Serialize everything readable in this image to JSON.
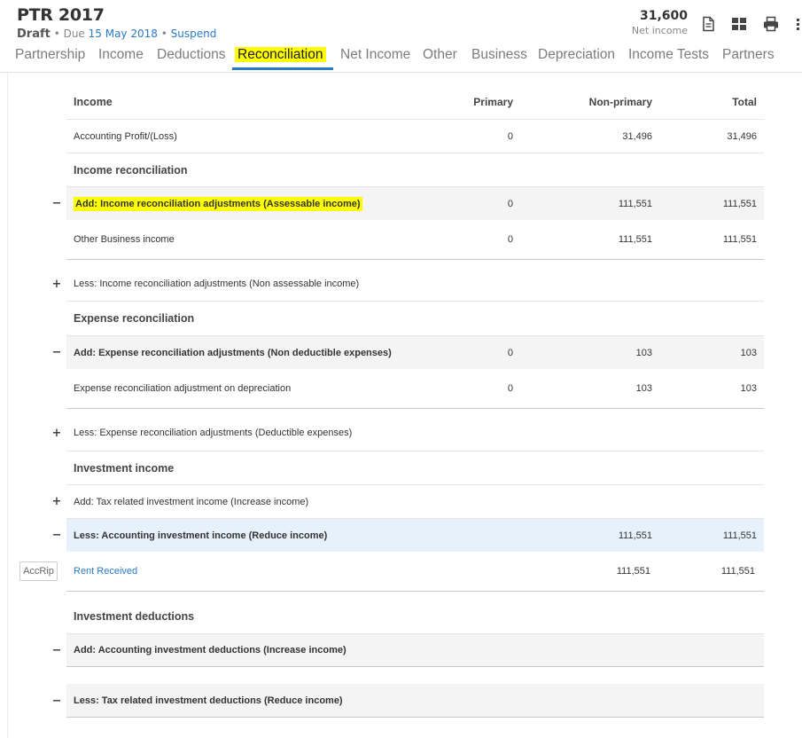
{
  "header": {
    "title": "PTR 2017",
    "status": "Draft",
    "due_prefix": "• Due",
    "due_date": "15 May 2018",
    "separator": "•",
    "suspend": "Suspend",
    "net_income_value": "31,600",
    "net_income_label": "Net income",
    "icons": [
      "document-icon",
      "dashboard-grid-icon",
      "print-icon",
      "more-vertical-icon"
    ]
  },
  "tabs": [
    "Partnership",
    "Income",
    "Deductions",
    "Reconciliation",
    "Net Income",
    "Other",
    "Business",
    "Depreciation",
    "Income Tests",
    "Partners"
  ],
  "active_tab": "Reconciliation",
  "table": {
    "headers": {
      "label": "Income",
      "primary": "Primary",
      "non_primary": "Non-primary",
      "total": "Total"
    },
    "rows": [
      {
        "label": "Accounting Profit/(Loss)",
        "primary": "0",
        "non_primary": "31,496",
        "total": "31,496"
      },
      {
        "label": "Income reconciliation"
      },
      {
        "toggle": "−",
        "label": "Add: Income reconciliation adjustments (Assessable income)",
        "primary": "0",
        "non_primary": "111,551",
        "total": "111,551"
      },
      {
        "label": "Other Business income",
        "primary": "0",
        "non_primary": "111,551",
        "total": "111,551"
      },
      {
        "toggle": "+",
        "label": "Less: Income reconciliation adjustments (Non assessable income)"
      },
      {
        "label": "Expense reconciliation"
      },
      {
        "toggle": "−",
        "label": "Add: Expense reconciliation adjustments (Non deductible expenses)",
        "primary": "0",
        "non_primary": "103",
        "total": "103"
      },
      {
        "label": "Expense reconciliation adjustment on depreciation",
        "primary": "0",
        "non_primary": "103",
        "total": "103"
      },
      {
        "toggle": "+",
        "label": "Less: Expense reconciliation adjustments (Deductible expenses)"
      },
      {
        "label": "Investment income"
      },
      {
        "toggle": "+",
        "label": "Add: Tax related investment income (Increase income)"
      },
      {
        "toggle": "−",
        "label": "Less: Accounting investment income (Reduce income)",
        "non_primary": "111,551",
        "total": "111,551"
      },
      {
        "badge": "AccRip",
        "label": "Rent Received",
        "non_primary": "111,551",
        "total": "111,551"
      },
      {
        "label": "Investment deductions"
      },
      {
        "toggle": "−",
        "label": "Add: Accounting investment deductions (Increase income)"
      },
      {
        "toggle": "−",
        "label": "Less: Tax related investment deductions (Reduce income)"
      }
    ]
  },
  "colors": {
    "link": "#2a7ac5",
    "highlight": "#ffff00",
    "selected_row": "#e7f1fb",
    "grey_row": "#f4f4f4"
  }
}
